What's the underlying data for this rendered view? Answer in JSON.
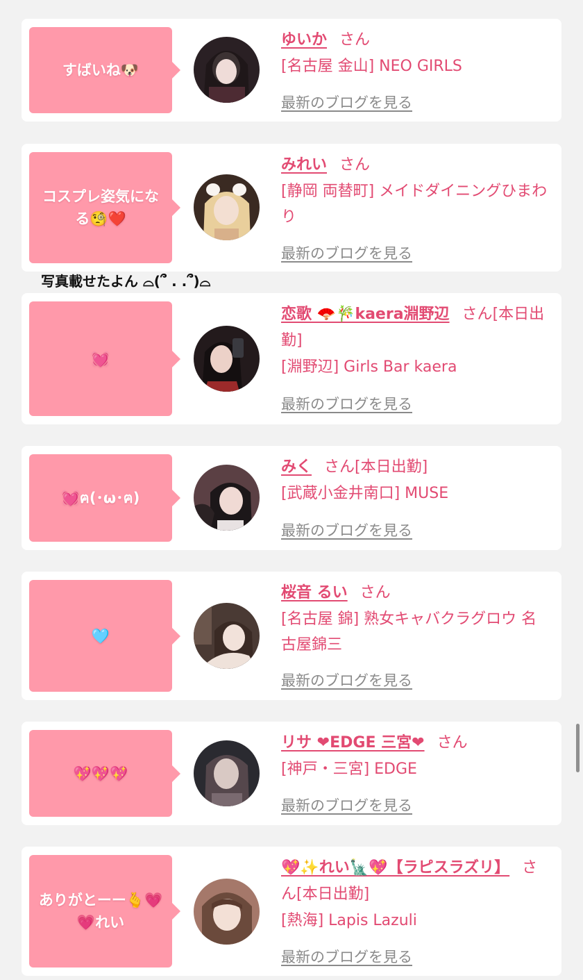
{
  "comment": "写真載せたよん ⌓(՞ . .՞)⌓",
  "blog_link_label": "最新のブログを見る",
  "honorific": "さん",
  "cards": [
    {
      "bubble": "すばいね🐶",
      "name": "ゆいか",
      "name_suffix": "",
      "shop": "[名古屋 金山] NEO GIRLS",
      "avatar_colors": [
        "#2a2024",
        "#c9b4b8",
        "#4d2b33"
      ]
    },
    {
      "bubble": "コスプレ姿気になる🧐❤️",
      "name": "みれい",
      "name_suffix": "",
      "shop": "[静岡 両替町] メイドダイニングひまわり",
      "avatar_colors": [
        "#3a2a22",
        "#f0dcc8",
        "#d8b08a"
      ]
    },
    {
      "bubble": "💓",
      "name": "恋歌 🪭🎋kaera淵野辺",
      "name_suffix": "[本日出勤]",
      "shop": "[淵野辺] Girls Bar kaera",
      "avatar_colors": [
        "#231a1c",
        "#e6c6bd",
        "#9c2a2a"
      ]
    },
    {
      "bubble": "💓ฅ(･ω･ฅ)",
      "name": "みく",
      "name_suffix": "[本日出勤]",
      "shop": "[武蔵小金井南口] MUSE",
      "avatar_colors": [
        "#1c1719",
        "#ead2cc",
        "#5b4044"
      ]
    },
    {
      "bubble": "🩵",
      "name": "桜音 るい",
      "name_suffix": "",
      "shop": "[名古屋 錦] 熟女キャバクラグロウ 名古屋錦三",
      "avatar_colors": [
        "#4a3a34",
        "#efe2da",
        "#a88c7c"
      ]
    },
    {
      "bubble": "💖💖💖",
      "name": "リサ ❤EDGE 三宮❤",
      "name_suffix": "",
      "shop": "[神戸・三宮] EDGE",
      "avatar_colors": [
        "#2a2a30",
        "#d9c9c4",
        "#7a6a70"
      ]
    },
    {
      "bubble": "ありがとーー🫰💗💗れい",
      "name": "💖✨れい🗽💖【ラピスラズリ】",
      "name_suffix": "[本日出勤]",
      "shop": "[熱海] Lapis Lazuli",
      "avatar_colors": [
        "#6b4a3c",
        "#f3e0d6",
        "#a5786a"
      ]
    }
  ],
  "colors": {
    "background": "#f2f2f2",
    "card": "#ffffff",
    "bubble": "#ff99aa",
    "accent_text": "#e24a72",
    "link_gray": "#8a8a8a"
  }
}
